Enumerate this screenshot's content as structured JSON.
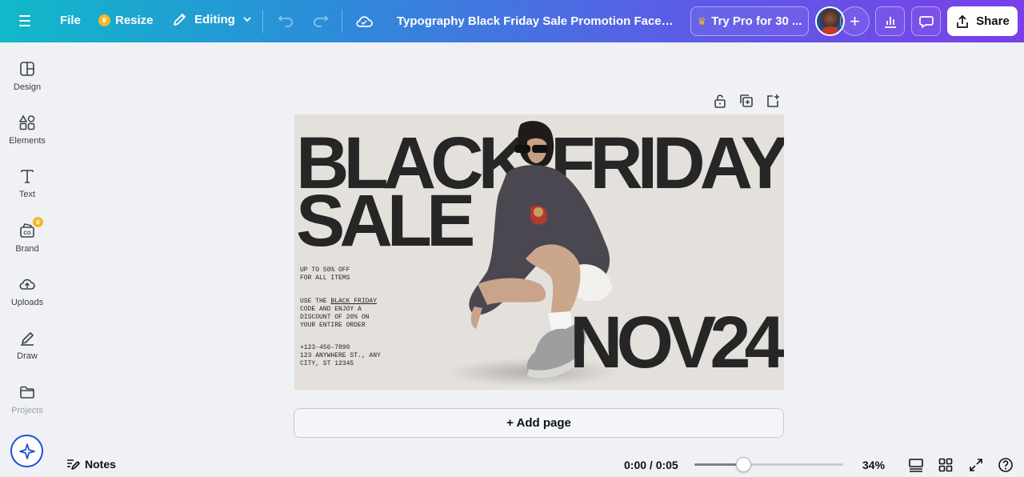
{
  "topbar": {
    "file_label": "File",
    "resize_label": "Resize",
    "editing_label": "Editing",
    "doc_title": "Typography Black Friday Sale Promotion Facebook E...",
    "try_pro_label": "Try Pro for 30 ...",
    "share_label": "Share",
    "gradient_start": "#10b9c9",
    "gradient_end": "#7a3fe8"
  },
  "sidebar": {
    "items": [
      {
        "label": "Design",
        "icon": "design-icon"
      },
      {
        "label": "Elements",
        "icon": "elements-icon"
      },
      {
        "label": "Text",
        "icon": "text-icon"
      },
      {
        "label": "Brand",
        "icon": "brand-icon"
      },
      {
        "label": "Uploads",
        "icon": "uploads-icon"
      },
      {
        "label": "Draw",
        "icon": "draw-icon"
      },
      {
        "label": "Projects",
        "icon": "projects-icon"
      }
    ]
  },
  "design": {
    "headline_1": "BLACK",
    "headline_friday": "FRIDAY",
    "headline_2": "SALE",
    "headline_3": "NOV24",
    "offer_text": "UP TO 50% OFF\nFOR ALL ITEMS",
    "code_prefix": "USE THE ",
    "code_link": "BLACK FRIDAY",
    "code_rest": "\nCODE AND ENJOY A\nDISCOUNT OF 20% ON\nYOUR ENTIRE ORDER",
    "contact_text": "+123-456-7890\n123 ANYWHERE ST., ANY\nCITY, ST 12345"
  },
  "canvas": {
    "add_page_label": "+ Add page"
  },
  "bottombar": {
    "notes_label": "Notes",
    "timer": "0:00 / 0:05",
    "timeline_progress": 0.33,
    "zoom_label": "34%"
  }
}
